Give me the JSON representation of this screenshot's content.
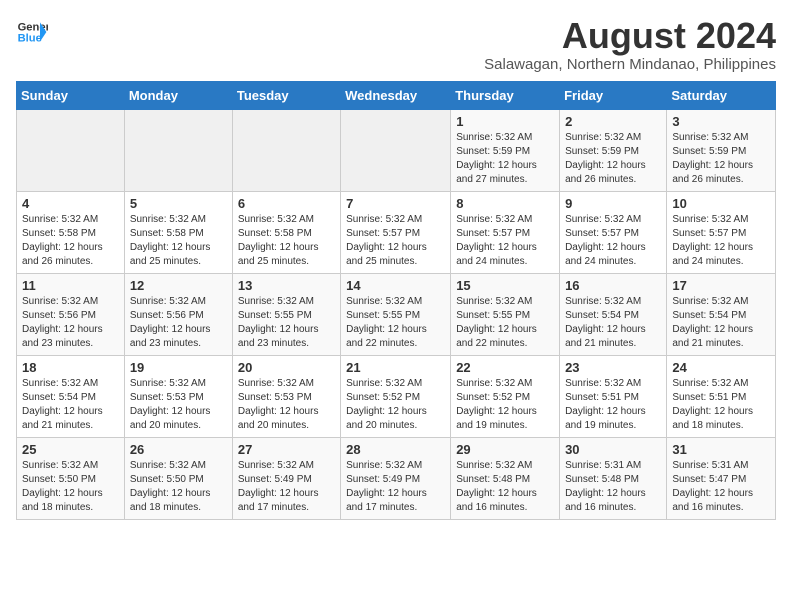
{
  "logo": {
    "line1": "General",
    "line2": "Blue"
  },
  "title": "August 2024",
  "location": "Salawagan, Northern Mindanao, Philippines",
  "days_of_week": [
    "Sunday",
    "Monday",
    "Tuesday",
    "Wednesday",
    "Thursday",
    "Friday",
    "Saturday"
  ],
  "weeks": [
    [
      {
        "day": "",
        "info": ""
      },
      {
        "day": "",
        "info": ""
      },
      {
        "day": "",
        "info": ""
      },
      {
        "day": "",
        "info": ""
      },
      {
        "day": "1",
        "info": "Sunrise: 5:32 AM\nSunset: 5:59 PM\nDaylight: 12 hours and 27 minutes."
      },
      {
        "day": "2",
        "info": "Sunrise: 5:32 AM\nSunset: 5:59 PM\nDaylight: 12 hours and 26 minutes."
      },
      {
        "day": "3",
        "info": "Sunrise: 5:32 AM\nSunset: 5:59 PM\nDaylight: 12 hours and 26 minutes."
      }
    ],
    [
      {
        "day": "4",
        "info": "Sunrise: 5:32 AM\nSunset: 5:58 PM\nDaylight: 12 hours and 26 minutes."
      },
      {
        "day": "5",
        "info": "Sunrise: 5:32 AM\nSunset: 5:58 PM\nDaylight: 12 hours and 25 minutes."
      },
      {
        "day": "6",
        "info": "Sunrise: 5:32 AM\nSunset: 5:58 PM\nDaylight: 12 hours and 25 minutes."
      },
      {
        "day": "7",
        "info": "Sunrise: 5:32 AM\nSunset: 5:57 PM\nDaylight: 12 hours and 25 minutes."
      },
      {
        "day": "8",
        "info": "Sunrise: 5:32 AM\nSunset: 5:57 PM\nDaylight: 12 hours and 24 minutes."
      },
      {
        "day": "9",
        "info": "Sunrise: 5:32 AM\nSunset: 5:57 PM\nDaylight: 12 hours and 24 minutes."
      },
      {
        "day": "10",
        "info": "Sunrise: 5:32 AM\nSunset: 5:57 PM\nDaylight: 12 hours and 24 minutes."
      }
    ],
    [
      {
        "day": "11",
        "info": "Sunrise: 5:32 AM\nSunset: 5:56 PM\nDaylight: 12 hours and 23 minutes."
      },
      {
        "day": "12",
        "info": "Sunrise: 5:32 AM\nSunset: 5:56 PM\nDaylight: 12 hours and 23 minutes."
      },
      {
        "day": "13",
        "info": "Sunrise: 5:32 AM\nSunset: 5:55 PM\nDaylight: 12 hours and 23 minutes."
      },
      {
        "day": "14",
        "info": "Sunrise: 5:32 AM\nSunset: 5:55 PM\nDaylight: 12 hours and 22 minutes."
      },
      {
        "day": "15",
        "info": "Sunrise: 5:32 AM\nSunset: 5:55 PM\nDaylight: 12 hours and 22 minutes."
      },
      {
        "day": "16",
        "info": "Sunrise: 5:32 AM\nSunset: 5:54 PM\nDaylight: 12 hours and 21 minutes."
      },
      {
        "day": "17",
        "info": "Sunrise: 5:32 AM\nSunset: 5:54 PM\nDaylight: 12 hours and 21 minutes."
      }
    ],
    [
      {
        "day": "18",
        "info": "Sunrise: 5:32 AM\nSunset: 5:54 PM\nDaylight: 12 hours and 21 minutes."
      },
      {
        "day": "19",
        "info": "Sunrise: 5:32 AM\nSunset: 5:53 PM\nDaylight: 12 hours and 20 minutes."
      },
      {
        "day": "20",
        "info": "Sunrise: 5:32 AM\nSunset: 5:53 PM\nDaylight: 12 hours and 20 minutes."
      },
      {
        "day": "21",
        "info": "Sunrise: 5:32 AM\nSunset: 5:52 PM\nDaylight: 12 hours and 20 minutes."
      },
      {
        "day": "22",
        "info": "Sunrise: 5:32 AM\nSunset: 5:52 PM\nDaylight: 12 hours and 19 minutes."
      },
      {
        "day": "23",
        "info": "Sunrise: 5:32 AM\nSunset: 5:51 PM\nDaylight: 12 hours and 19 minutes."
      },
      {
        "day": "24",
        "info": "Sunrise: 5:32 AM\nSunset: 5:51 PM\nDaylight: 12 hours and 18 minutes."
      }
    ],
    [
      {
        "day": "25",
        "info": "Sunrise: 5:32 AM\nSunset: 5:50 PM\nDaylight: 12 hours and 18 minutes."
      },
      {
        "day": "26",
        "info": "Sunrise: 5:32 AM\nSunset: 5:50 PM\nDaylight: 12 hours and 18 minutes."
      },
      {
        "day": "27",
        "info": "Sunrise: 5:32 AM\nSunset: 5:49 PM\nDaylight: 12 hours and 17 minutes."
      },
      {
        "day": "28",
        "info": "Sunrise: 5:32 AM\nSunset: 5:49 PM\nDaylight: 12 hours and 17 minutes."
      },
      {
        "day": "29",
        "info": "Sunrise: 5:32 AM\nSunset: 5:48 PM\nDaylight: 12 hours and 16 minutes."
      },
      {
        "day": "30",
        "info": "Sunrise: 5:31 AM\nSunset: 5:48 PM\nDaylight: 12 hours and 16 minutes."
      },
      {
        "day": "31",
        "info": "Sunrise: 5:31 AM\nSunset: 5:47 PM\nDaylight: 12 hours and 16 minutes."
      }
    ]
  ]
}
